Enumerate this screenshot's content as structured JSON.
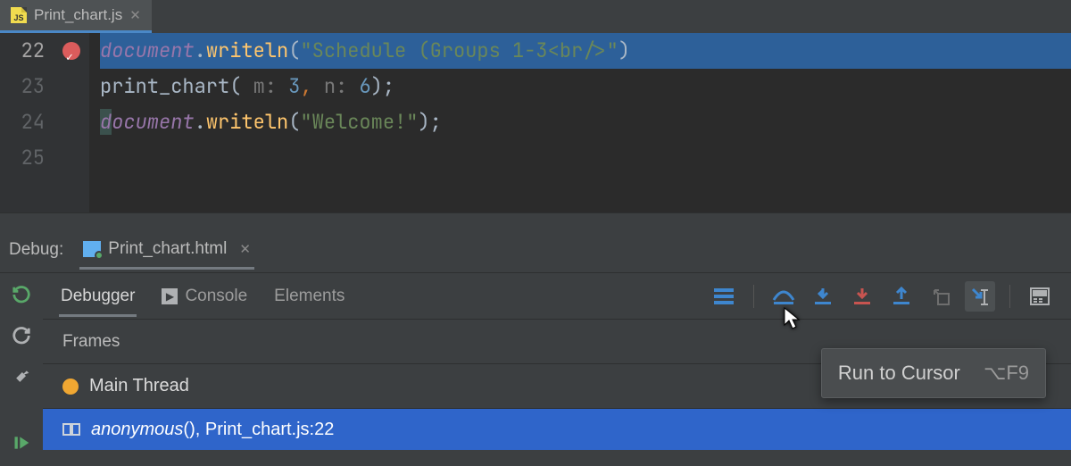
{
  "tab": {
    "title": "Print_chart.js",
    "badge": "JS"
  },
  "editor": {
    "lines": [
      {
        "n": "22",
        "kind": "exec",
        "seg": {
          "doc": "document",
          "dot1": ".",
          "method": "writeln",
          "open": "(",
          "str": "\"Schedule (Groups 1-3<br/>\"",
          "close": ")"
        }
      },
      {
        "n": "23",
        "kind": "plain",
        "seg": {
          "call": "print_chart( ",
          "h1": "m: ",
          "n1": "3",
          "c1": ",",
          "sp": " ",
          "h2": "n: ",
          "n2": "6",
          "close": ");"
        }
      },
      {
        "n": "24",
        "kind": "plain2",
        "seg": {
          "boxd": "d",
          "doc": "ocument",
          "dot": ".",
          "method": "writeln",
          "open": "(",
          "str": "\"Welcome!\"",
          "close": ");"
        }
      },
      {
        "n": "25"
      }
    ]
  },
  "debug": {
    "label": "Debug:",
    "session_tab": "Print_chart.html",
    "tabs": {
      "debugger": "Debugger",
      "console": "Console",
      "elements": "Elements"
    },
    "frames_label": "Frames",
    "thread": "Main Thread",
    "frame": {
      "name": "anonymous",
      "loc": ", Print_chart.js:22"
    }
  },
  "tooltip": {
    "text": "Run to Cursor",
    "shortcut": "⌥F9"
  }
}
